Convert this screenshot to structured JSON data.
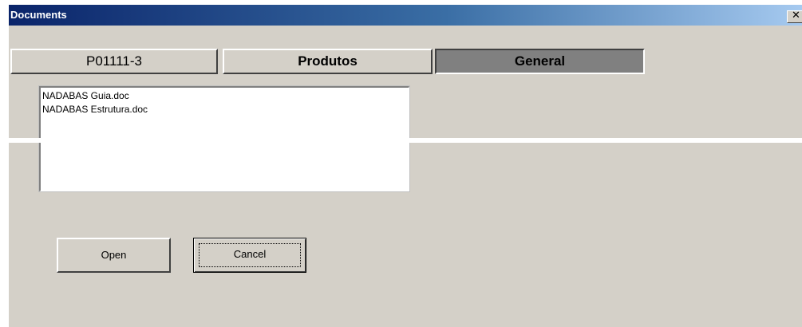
{
  "window": {
    "title": "Documents",
    "close_glyph": "✕"
  },
  "tabs": [
    {
      "label": "P01111-3",
      "active": false
    },
    {
      "label": "Produtos",
      "active": false
    },
    {
      "label": "General",
      "active": true
    }
  ],
  "files": [
    "NADABAS Guia.doc",
    "NADABAS Estrutura.doc"
  ],
  "buttons": {
    "open_label": "Open",
    "cancel_label": "Cancel"
  },
  "colors": {
    "dialog_face": "#d4d0c8",
    "titlebar_start": "#0a246a",
    "titlebar_end": "#a6caf0",
    "active_tab": "#808080"
  }
}
